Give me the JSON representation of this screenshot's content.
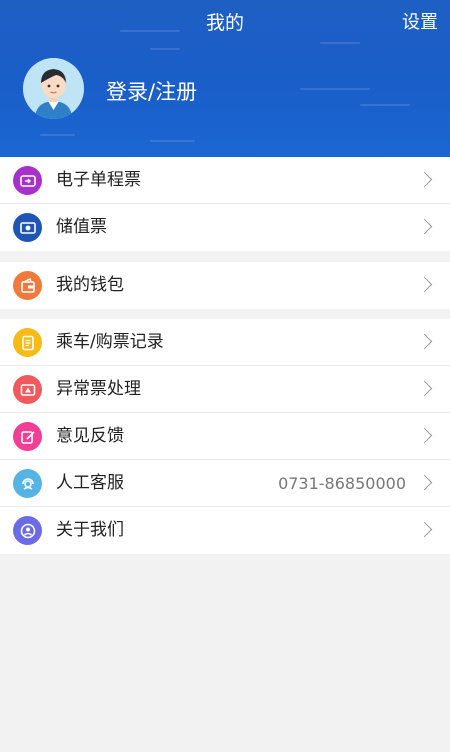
{
  "header": {
    "title": "我的",
    "settings_label": "设置",
    "login_label": "登录/注册",
    "bg_color": "#1a5ec9"
  },
  "groups": [
    {
      "items": [
        {
          "label": "电子单程票",
          "icon": "ticket-icon",
          "color": "#a632c9"
        },
        {
          "label": "储值票",
          "icon": "card-icon",
          "color": "#1e56b6"
        }
      ]
    },
    {
      "items": [
        {
          "label": "我的钱包",
          "icon": "wallet-icon",
          "color": "#f07a3b"
        }
      ]
    },
    {
      "items": [
        {
          "label": "乘车/购票记录",
          "icon": "record-icon",
          "color": "#f6bb16"
        },
        {
          "label": "异常票处理",
          "icon": "exception-ticket-icon",
          "color": "#f05a5e"
        },
        {
          "label": "意见反馈",
          "icon": "feedback-icon",
          "color": "#f23f95"
        },
        {
          "label": "人工客服",
          "icon": "customer-service-icon",
          "color": "#56b4e5",
          "value": "0731-86850000"
        },
        {
          "label": "关于我们",
          "icon": "about-icon",
          "color": "#6b6be6"
        }
      ]
    }
  ]
}
